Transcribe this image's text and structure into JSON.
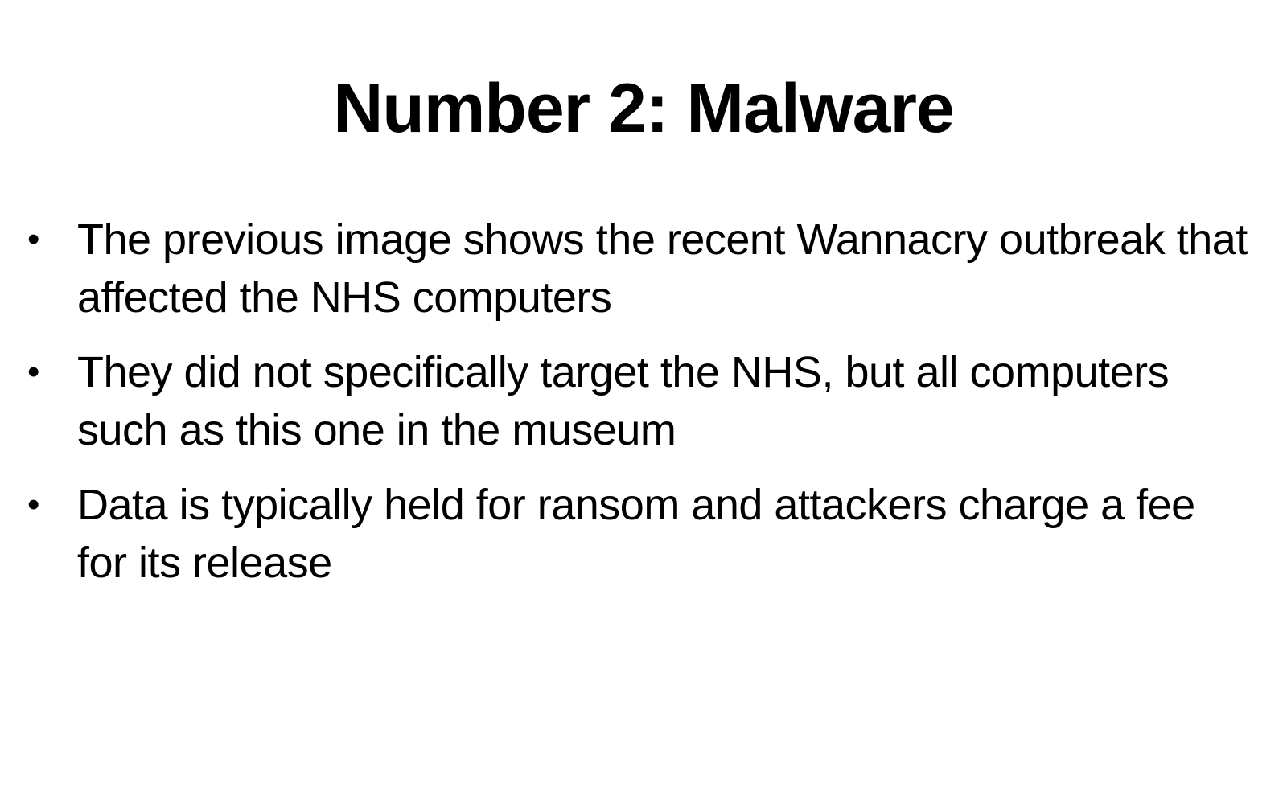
{
  "slide": {
    "title": "Number 2: Malware",
    "bullet_symbol": "•",
    "bullets": [
      "The previous image shows the recent Wannacry outbreak that affected the NHS computers",
      "They did not specifically target the NHS, but all computers such as this one in the museum",
      "Data is typically held for ransom and attackers charge a fee for its release"
    ]
  }
}
